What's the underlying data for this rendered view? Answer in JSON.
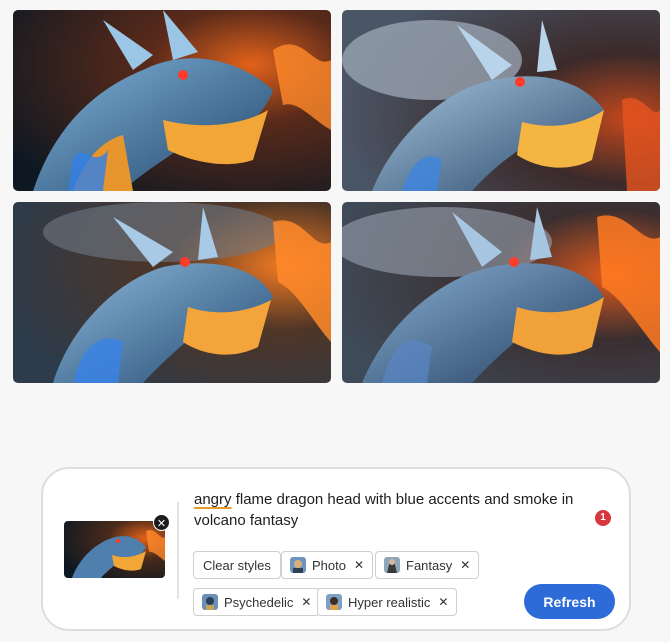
{
  "gallery": {
    "images": [
      {
        "id": "dragon-1",
        "description_icon": "dragon-head-image"
      },
      {
        "id": "dragon-2",
        "description_icon": "dragon-head-image"
      },
      {
        "id": "dragon-3",
        "description_icon": "dragon-head-image"
      },
      {
        "id": "dragon-4",
        "description_icon": "dragon-head-image"
      }
    ]
  },
  "prompt": {
    "highlighted_word": "angry",
    "rest_text": " flame dragon head with blue accents and smoke in volcano fantasy",
    "badge_count": "1"
  },
  "reference": {
    "close_label": "✕"
  },
  "styles": {
    "clear_label": "Clear styles",
    "chips": [
      {
        "label": "Photo",
        "remove": "✕"
      },
      {
        "label": "Fantasy",
        "remove": "✕"
      },
      {
        "label": "Psychedelic",
        "remove": "✕"
      },
      {
        "label": "Hyper realistic",
        "remove": "✕"
      }
    ]
  },
  "actions": {
    "refresh_label": "Refresh"
  },
  "colors": {
    "accent": "#2d6bd8",
    "badge": "#d7373f",
    "spell_underline": "#e89a2a"
  }
}
